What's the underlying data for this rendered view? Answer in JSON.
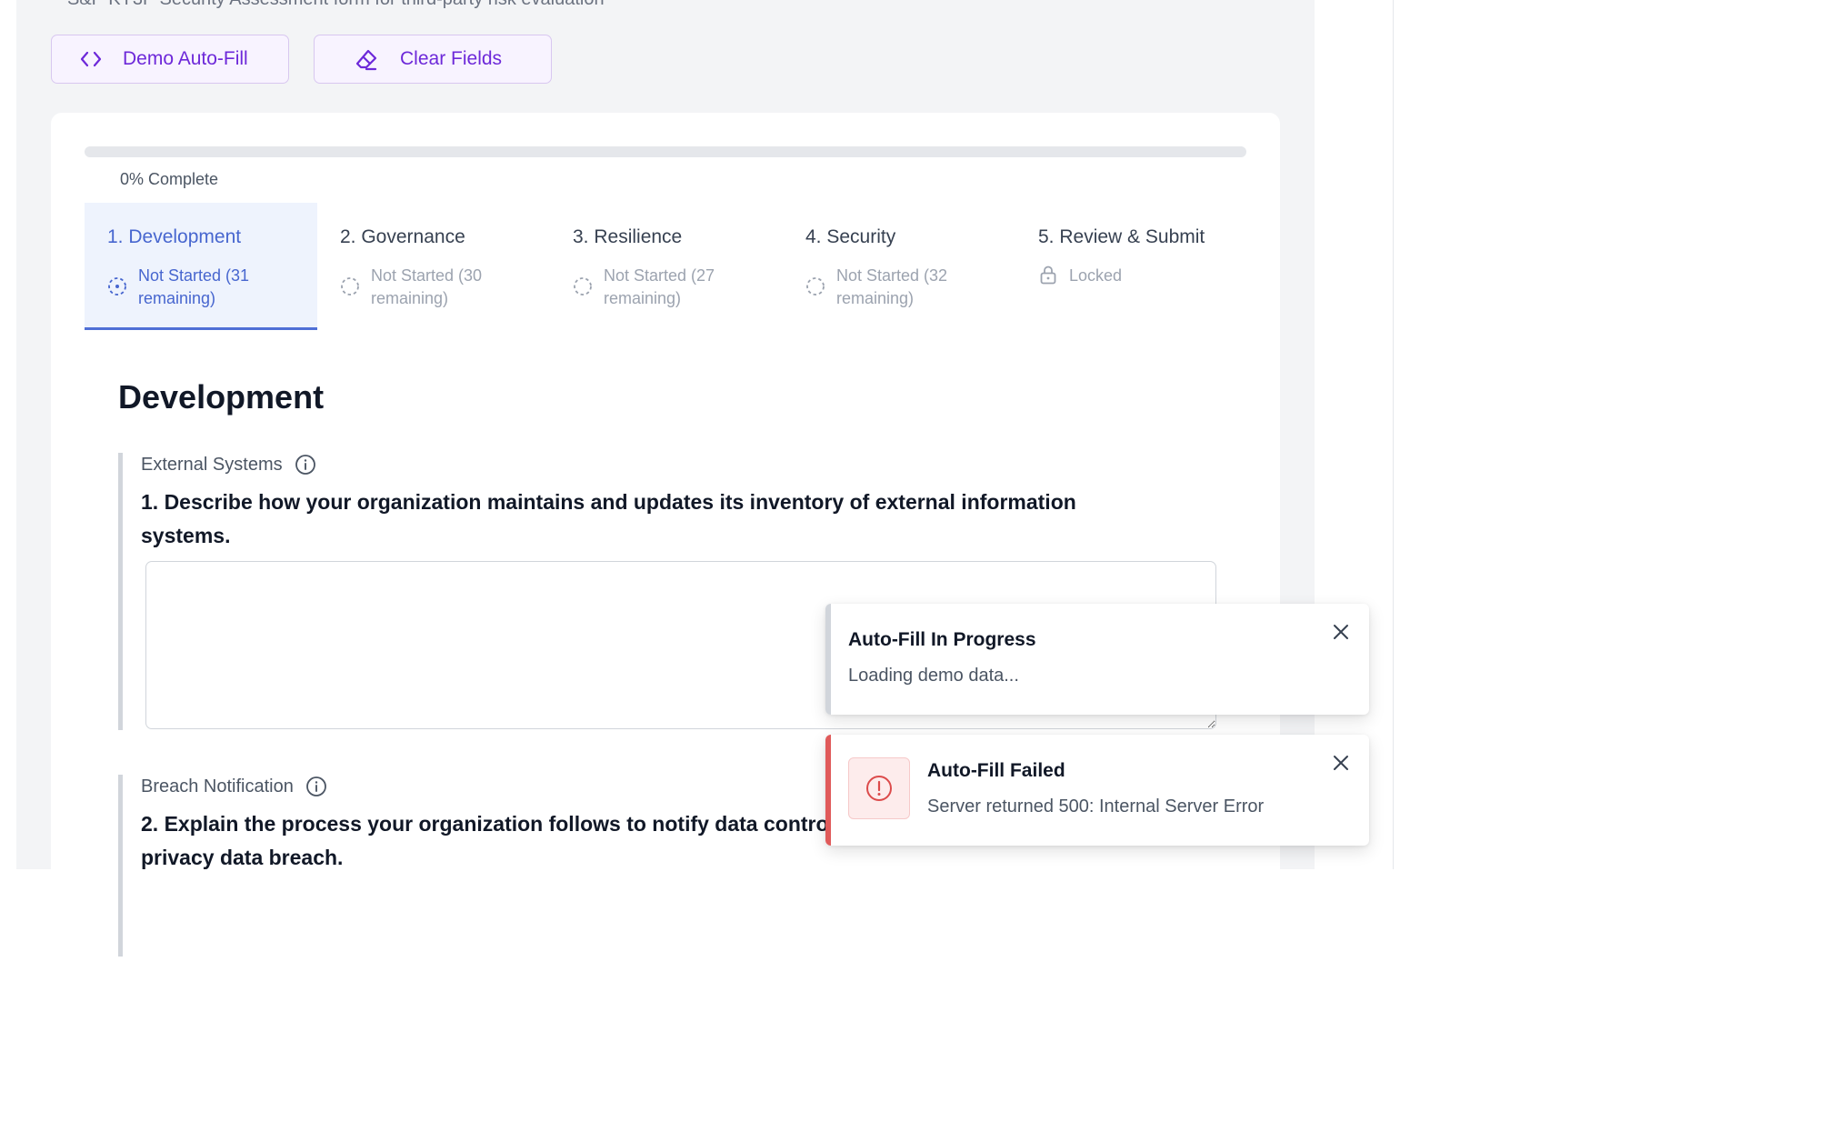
{
  "header": {
    "subtitle": "S&P KY3P Security Assessment form for third-party risk evaluation"
  },
  "toolbar": {
    "autofill_label": "Demo Auto-Fill",
    "autofill_icon": "code-brackets-icon",
    "clear_label": "Clear Fields",
    "clear_icon": "eraser-icon"
  },
  "progress": {
    "value": 0,
    "label": "0% Complete"
  },
  "tabs": [
    {
      "title": "1. Development",
      "status": "Not Started (31 remaining)",
      "active": true,
      "icon": "dashed-circle-icon"
    },
    {
      "title": "2. Governance",
      "status": "Not Started (30 remaining)",
      "active": false,
      "icon": "dashed-circle-icon"
    },
    {
      "title": "3. Resilience",
      "status": "Not Started (27 remaining)",
      "active": false,
      "icon": "dashed-circle-icon"
    },
    {
      "title": "4. Security",
      "status": "Not Started (32 remaining)",
      "active": false,
      "icon": "dashed-circle-icon"
    },
    {
      "title": "5. Review & Submit",
      "status": "Locked",
      "active": false,
      "icon": "lock-icon"
    }
  ],
  "section": {
    "title": "Development",
    "questions": [
      {
        "category": "External Systems",
        "text": "1. Describe how your organization maintains and updates its inventory of external information systems.",
        "answer": ""
      },
      {
        "category": "Breach Notification",
        "text": "2. Explain the process your organization follows to notify data controllers when it becomes aware of a privacy data breach."
      }
    ]
  },
  "toasts": [
    {
      "title": "Auto-Fill In Progress",
      "message": "Loading demo data...",
      "type": "info"
    },
    {
      "title": "Auto-Fill Failed",
      "message": "Server returned 500: Internal Server Error",
      "type": "error"
    }
  ],
  "colors": {
    "accent_blue": "#4766cf",
    "accent_purple": "#6d28d9",
    "error_red": "#e05a5a"
  }
}
